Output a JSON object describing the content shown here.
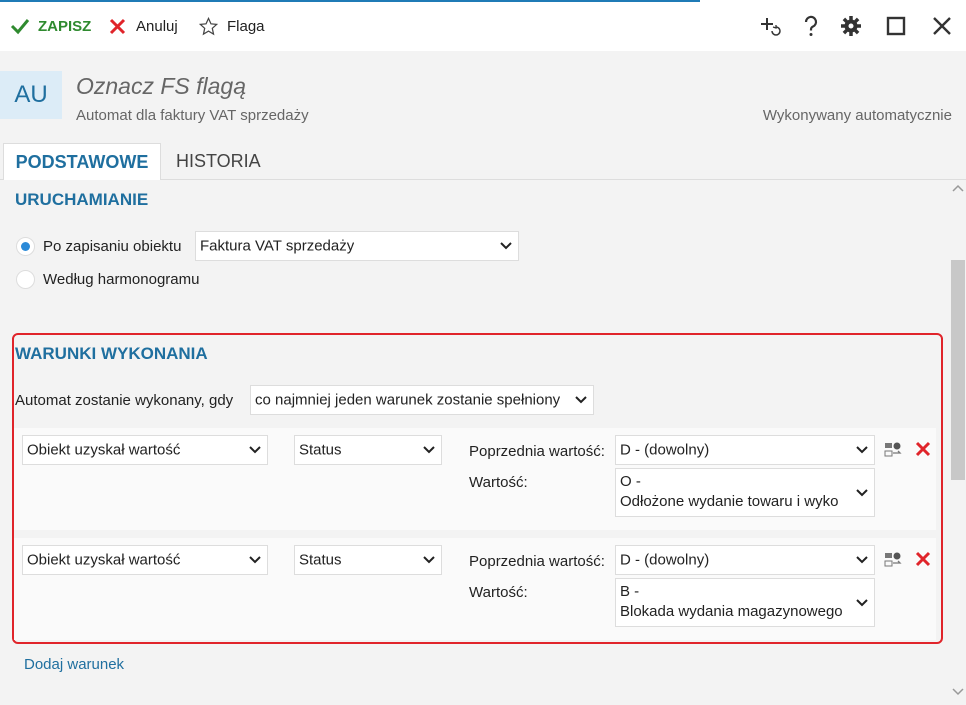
{
  "toolbar": {
    "save_label": "ZAPISZ",
    "cancel_label": "Anuluj",
    "flag_label": "Flaga"
  },
  "header": {
    "badge": "AU",
    "title": "Oznacz FS flagą",
    "subtitle": "Automat dla faktury VAT sprzedaży",
    "mode": "Wykonywany automatycznie"
  },
  "tabs": [
    {
      "label": "PODSTAWOWE",
      "active": true
    },
    {
      "label": "HISTORIA",
      "active": false
    }
  ],
  "trigger": {
    "title": "URUCHAMIANIE",
    "option_save": "Po zapisaniu obiektu",
    "option_schedule": "Według harmonogramu",
    "selected": "save",
    "object_type": "Faktura VAT sprzedaży"
  },
  "conditions": {
    "title": "WARUNKI WYKONANIA",
    "intro": "Automat zostanie wykonany, gdy",
    "mode": "co najmniej jeden warunek zostanie spełniony",
    "prev_label": "Poprzednia wartość:",
    "value_label": "Wartość:",
    "rows": [
      {
        "kind": "Obiekt uzyskał wartość",
        "field": "Status",
        "prev": "D - (dowolny)",
        "value_line1": "O -",
        "value_line2": "Odłożone wydanie towaru i wyko"
      },
      {
        "kind": "Obiekt uzyskał wartość",
        "field": "Status",
        "prev": "D - (dowolny)",
        "value_line1": "B -",
        "value_line2": "Blokada wydania magazynowego"
      }
    ],
    "add_label": "Dodaj warunek"
  },
  "colors": {
    "accent": "#1f6f9f",
    "save_green": "#2f8a2f",
    "delete_red": "#e0242a",
    "highlight_red": "#e0242a"
  },
  "icons": {
    "save": "check-icon",
    "cancel": "x-icon",
    "flag": "star-icon",
    "add_shortcut": "add-shortcut-icon",
    "help": "question-icon",
    "settings": "gear-icon",
    "maximize": "square-icon",
    "close": "close-icon"
  }
}
